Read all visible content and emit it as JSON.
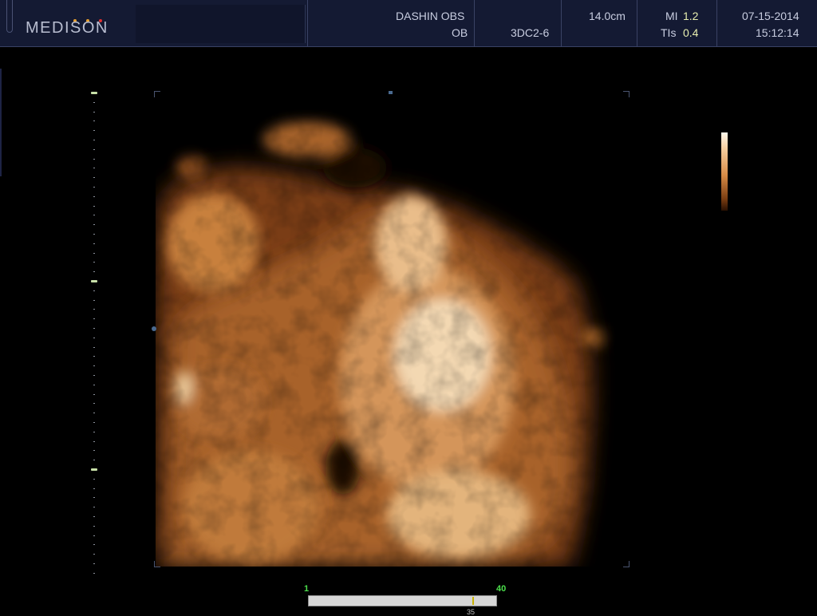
{
  "header": {
    "brand": "MEDISON",
    "brand_dot_colors": [
      "#e8a030",
      "#e8a030",
      "#e03030"
    ],
    "institution": "DASHIN OBS",
    "application": "OB",
    "probe": "3DC2-6",
    "depth": "14.0cm",
    "mi_label": "MI",
    "mi_value": "1.2",
    "tis_label": "TIs",
    "tis_value": "0.4",
    "date": "07-15-2014",
    "time": "15:12:14"
  },
  "colors": {
    "header_bg": "#141a33",
    "value_text": "#e8efb0",
    "scale_major": "#c8e0a8",
    "cine_label": "#4ce04c",
    "render_tone": "#d78a45"
  },
  "cine": {
    "start_label": "1",
    "end_label": "40",
    "frame_label": "35",
    "position_fraction": 0.872
  },
  "icons": {
    "render_view": "3d-surface-render",
    "colorbar": "sepia-gray-map"
  }
}
